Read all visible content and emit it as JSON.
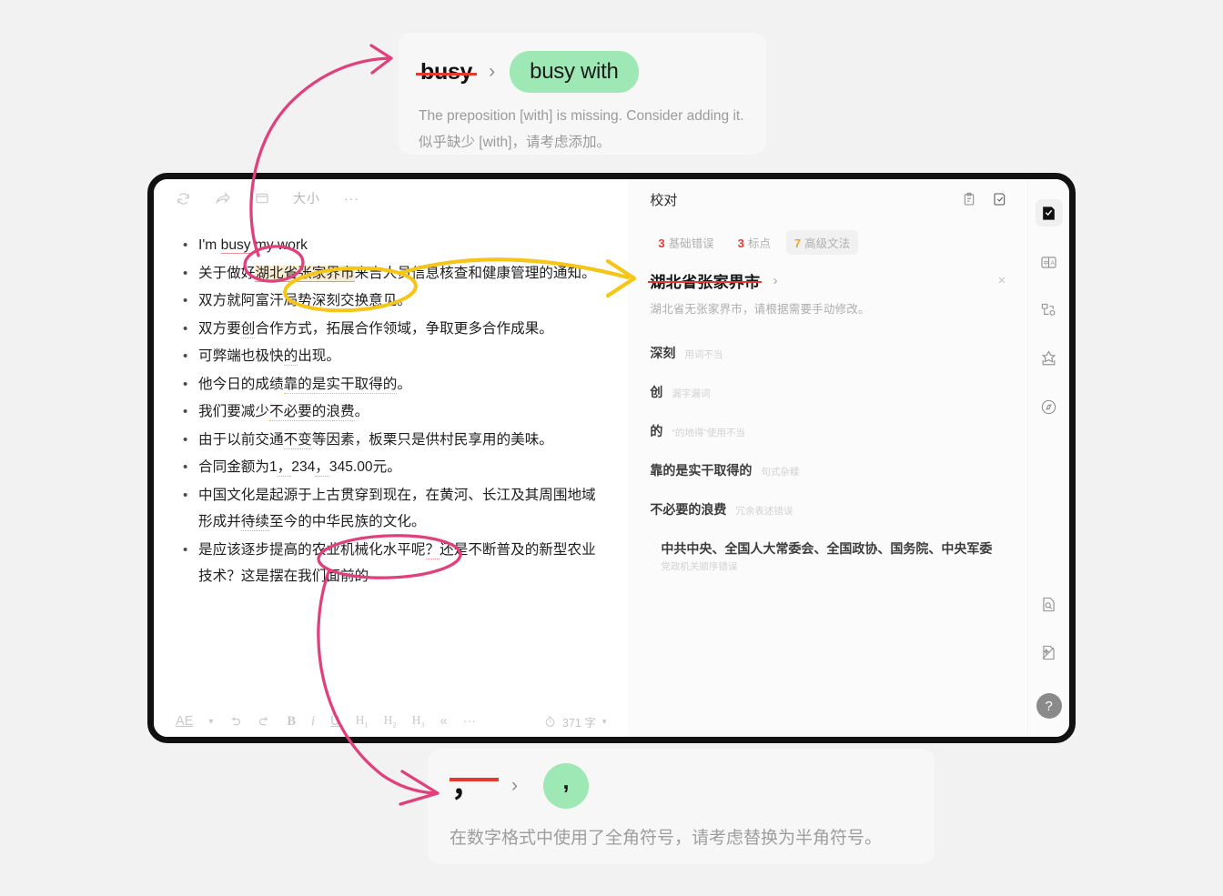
{
  "popup_top": {
    "original": "busy",
    "arrow": "›",
    "suggestion": "busy with",
    "desc_en": "The preposition [with] is missing. Consider adding it.",
    "desc_zh": "似乎缺少 [with]，请考虑添加。"
  },
  "popup_bottom": {
    "original": "，",
    "arrow": "›",
    "suggestion": ",",
    "desc_zh": "在数字格式中使用了全角符号，请考虑替换为半角符号。"
  },
  "editor": {
    "toolbar_top": {
      "refresh": "refresh-icon",
      "share": "share-icon",
      "card": "card-icon",
      "font_size": "大小",
      "more": "···"
    },
    "lines": [
      "I'm busy my work",
      "关于做好湖北省张家界市来吉人员信息核查和健康管理的通知。",
      "双方就阿富汗局势深刻交换意见。",
      "双方要创合作方式，拓展合作领域，争取更多合作成果。",
      "可弊端也极快的出现。",
      "他今日的成绩靠的是实干取得的。",
      "我们要减少不必要的浪费。",
      "由于以前交通不变等因素，板栗只是供村民享用的美味。",
      "合同金额为1，234，345.00元。",
      "中国文化是起源于上古贯穿到现在，在黄河、长江及其周围地域形成并待续至今的中华民族的文化。",
      "是应该逐步提高的农业机械化水平呢？还是不断普及的新型农业技术？这是摆在我们面前的"
    ],
    "toolbar_bottom": {
      "style": "AE",
      "undo": "undo-icon",
      "redo": "redo-icon",
      "bold": "B",
      "italic": "i",
      "underline": "U",
      "h1": "H1",
      "h2": "H2",
      "h3": "H3",
      "quote": "«",
      "more": "···",
      "timer": "timer-icon",
      "word_count": "371 字",
      "caret": "▾"
    }
  },
  "panel": {
    "title": "校对",
    "head_icons": [
      "clipboard-icon",
      "checklist-icon"
    ],
    "badges": [
      {
        "num": "3",
        "label": "基础错误"
      },
      {
        "num": "3",
        "label": "标点"
      },
      {
        "num": "7",
        "label": "高级文法"
      }
    ],
    "active": {
      "term": "湖北省张家界市",
      "chevron": "›",
      "close": "×",
      "desc": "湖北省无张家界市，请根据需要手动修改。"
    },
    "items": [
      {
        "term": "深刻",
        "tag": "用词不当"
      },
      {
        "term": "创",
        "tag": "漏字漏词"
      },
      {
        "term": "的",
        "tag": "“的地得”使用不当"
      },
      {
        "term": "靠的是实干取得的",
        "tag": "句式杂糅"
      },
      {
        "term": "不必要的浪费",
        "tag": "冗余表述错误"
      },
      {
        "term": "中共中央、全国人大常委会、全国政协、国务院、中央军委",
        "tag": "党政机关顺序错误"
      }
    ]
  },
  "rail": {
    "items": [
      "proofread-icon",
      "translate-icon",
      "flow-diagram-icon",
      "star-box-icon",
      "compass-icon"
    ],
    "bottom_items": [
      "document-search-icon",
      "document-sparkle-icon"
    ],
    "help": "?"
  },
  "colors": {
    "accent_green": "#9de8b4",
    "error_red": "#e8392f",
    "warn_orange": "#f0a22a",
    "annot_pink": "#e0417d",
    "annot_yellow": "#f5c518",
    "highlight": "#f8ecd2"
  }
}
